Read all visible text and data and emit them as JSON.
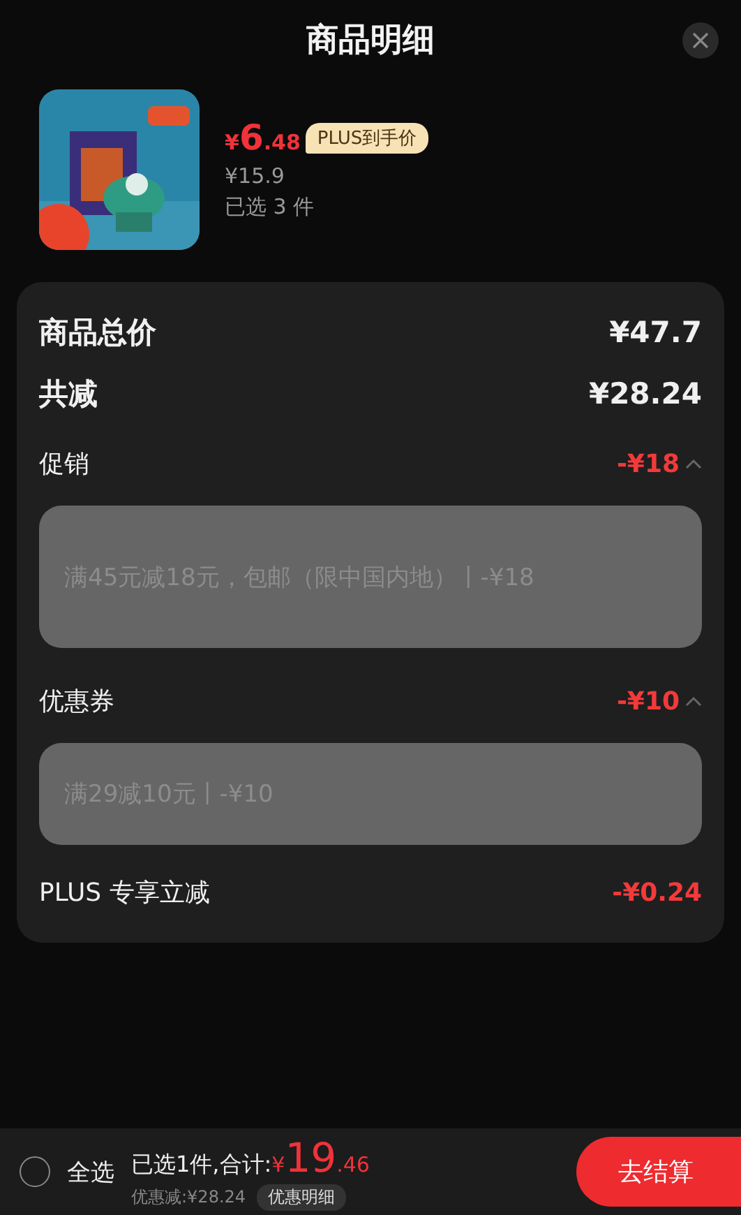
{
  "header": {
    "title": "商品明细"
  },
  "product": {
    "kind": "picture",
    "currency": "¥",
    "price_int": "6",
    "price_dec": ".48",
    "badge": "PLUS到手价",
    "original_price": "¥15.9",
    "quantity": "已选 3 件"
  },
  "summary": [
    {
      "kind": "total",
      "label": "商品总价",
      "amount": "¥47.7"
    },
    {
      "kind": "total",
      "label": "共减",
      "amount": "¥28.24"
    },
    {
      "kind": "group",
      "label": "促销",
      "amount": "-¥18",
      "expanded": true,
      "rules": [
        "满45元减18元，包邮（限中国内地）丨-¥18"
      ]
    },
    {
      "kind": "group",
      "label": "优惠券",
      "amount": "-¥10",
      "expanded": true,
      "rules": [
        "满29减10元丨-¥10"
      ]
    },
    {
      "kind": "plain",
      "label": "PLUS 专享立减",
      "amount": "-¥0.24"
    }
  ],
  "footer": {
    "select_all": {
      "label": "全选",
      "checked": false
    },
    "selected_text": "已选1件,合计:",
    "currency": "¥",
    "total_int": "19",
    "total_dec": ".46",
    "savings": "优惠减:¥28.24",
    "detail_button": "优惠明细",
    "checkout_button": "去结算"
  }
}
